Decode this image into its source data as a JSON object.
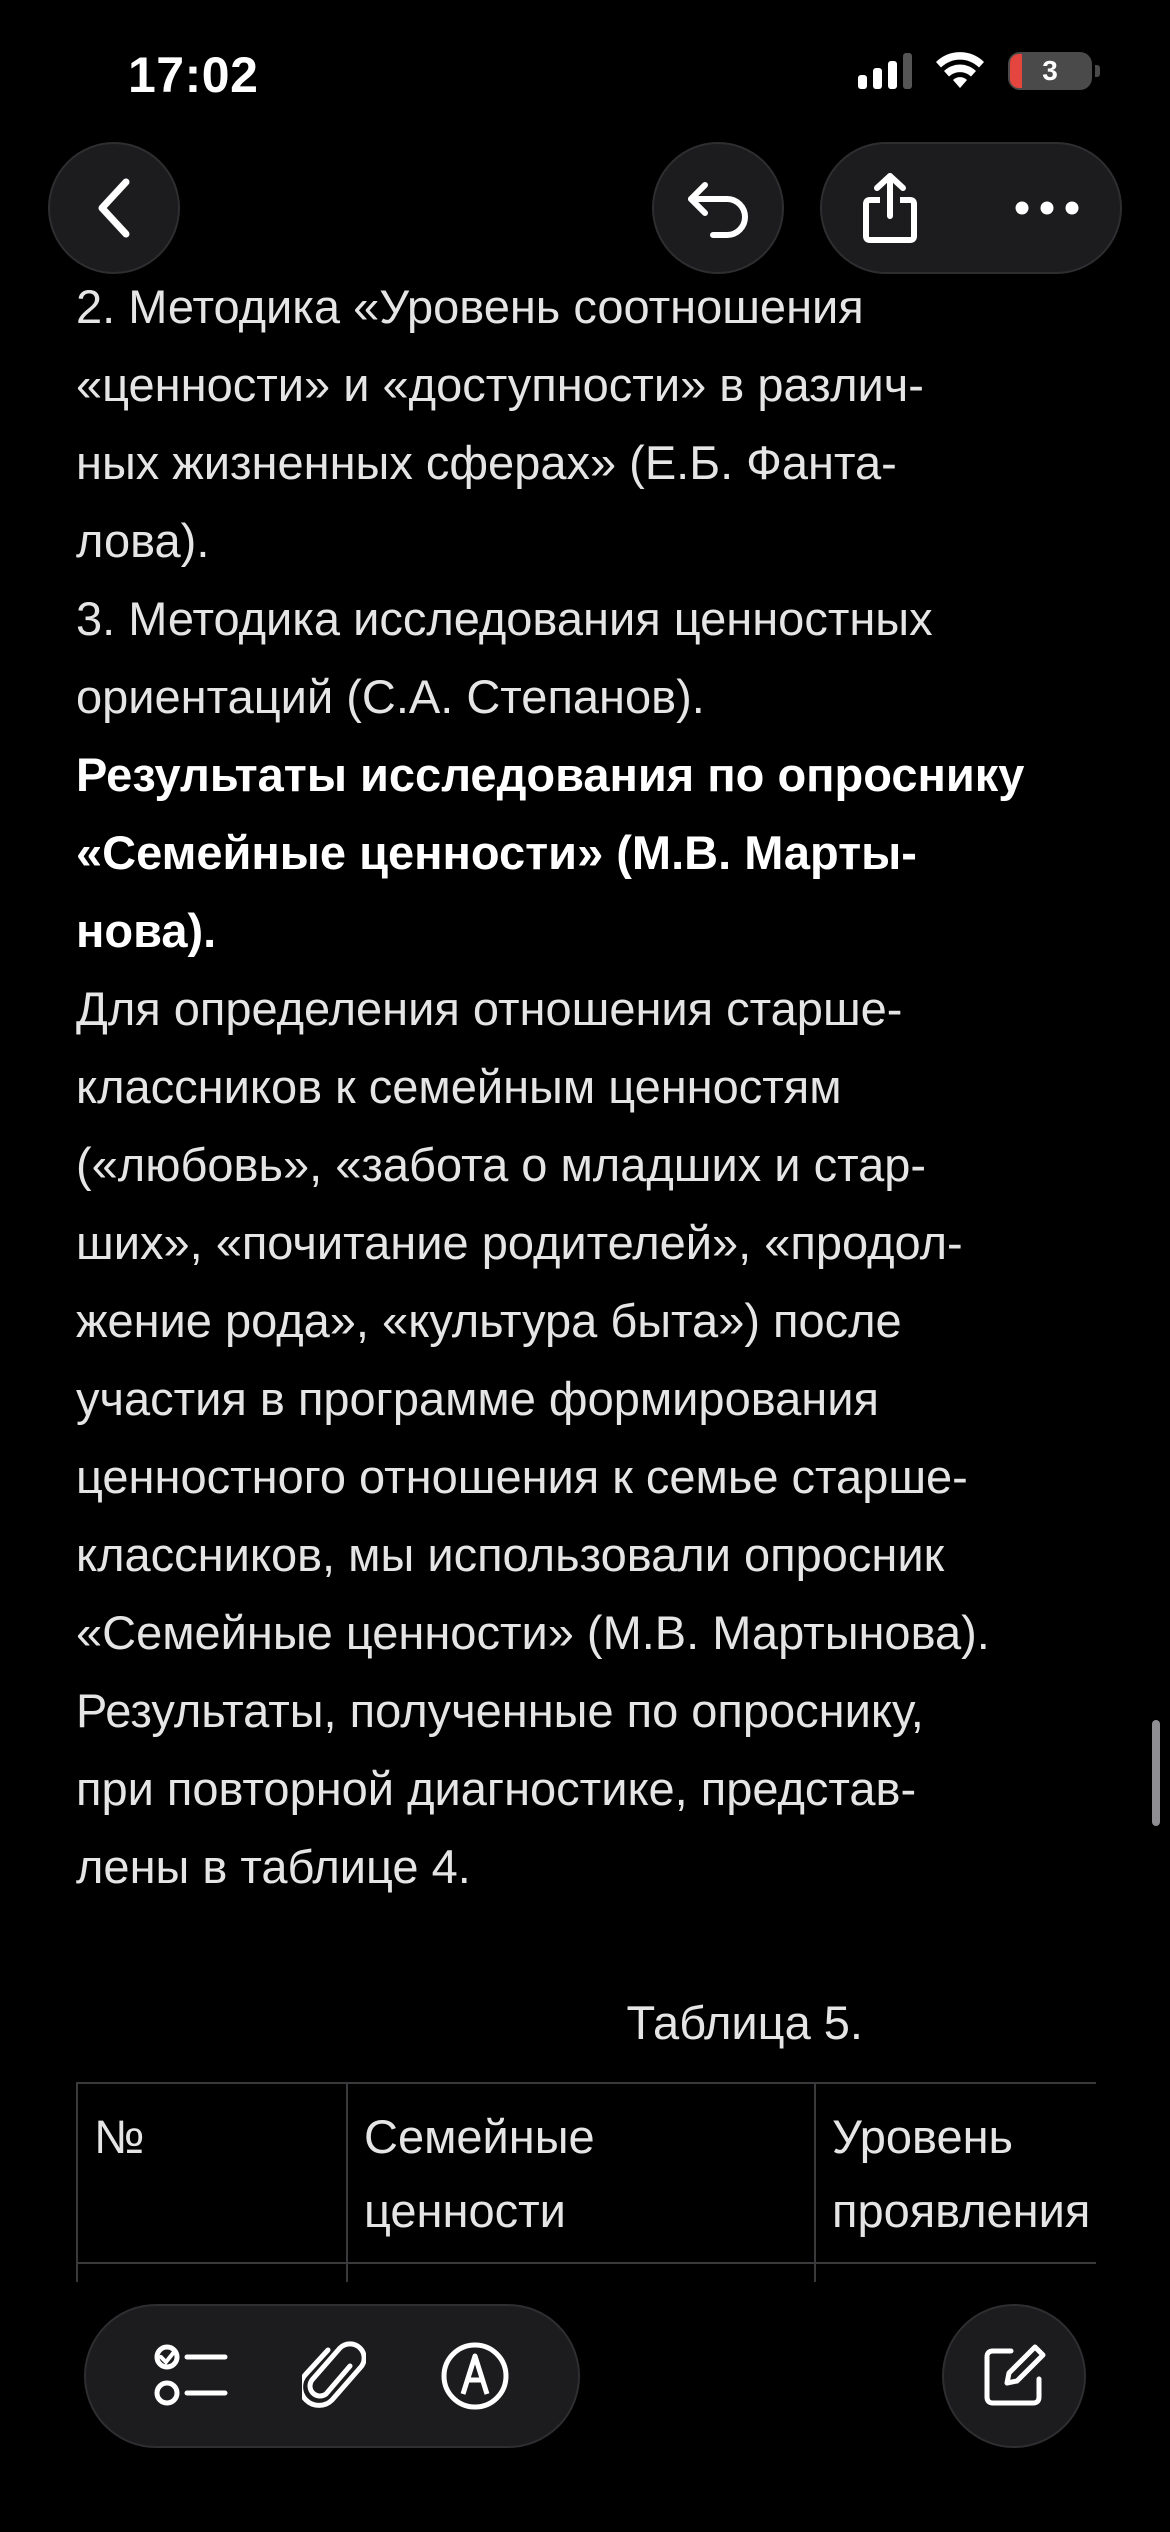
{
  "status_bar": {
    "time": "17:02",
    "battery_level": "3",
    "icons": [
      "cellular-signal-icon",
      "wifi-icon",
      "battery-icon"
    ]
  },
  "nav": {
    "icons": [
      "chevron-left-icon",
      "undo-icon",
      "share-icon",
      "more-icon"
    ]
  },
  "note": {
    "paragraphs": [
      {
        "text": "2. Методика «Уровень соотношения «ценности» и «доступности» в различных жизненных сферах» (Е.Б. Фантaлова).",
        "lines": [
          "2. Методика «Уровень соотношения",
          "«ценности» и «доступности» в различ-",
          "ных жизненных сферах» (Е.Б. Фанта-",
          "лова)."
        ]
      },
      {
        "text": "3. Методика исследования ценностных ориентаций (С.А. Степанов).",
        "lines": [
          "3. Методика исследования ценностных",
          "ориентаций (С.А. Степанов)."
        ]
      },
      {
        "text": "Результаты исследования по опроснику «Семейные ценности» (М.В. Мартынова).",
        "lines": [
          "Результаты исследования по опроснику",
          "«Семейные ценности» (М.В. Марты-",
          "нова)."
        ],
        "bold": true
      },
      {
        "text": "Для определения отношения старшеклассников к семейным ценностям...",
        "lines": [
          "Для определения отношения старше-",
          "классников к семейным ценностям",
          "(«любовь», «забота о младших и стар-",
          "ших», «почитание родителей», «продол-",
          "жение рода», «культура быта») после",
          "участия в программе формирования",
          "ценностного отношения к семье старше-",
          "классников, мы использовали опросник",
          "«Семейные ценности» (М.В. Мартынова).",
          "Результаты, полученные по опроснику,",
          "при повторной диагностике, представ-",
          "лены в таблице 4."
        ]
      }
    ],
    "table_caption": "Таблица 5.",
    "table_headers": [
      "№",
      "Семейные ценности",
      "Уровень проявления"
    ]
  },
  "toolbar": {
    "icons": [
      "checklist-icon",
      "attachment-icon",
      "markup-icon",
      "compose-icon"
    ]
  }
}
